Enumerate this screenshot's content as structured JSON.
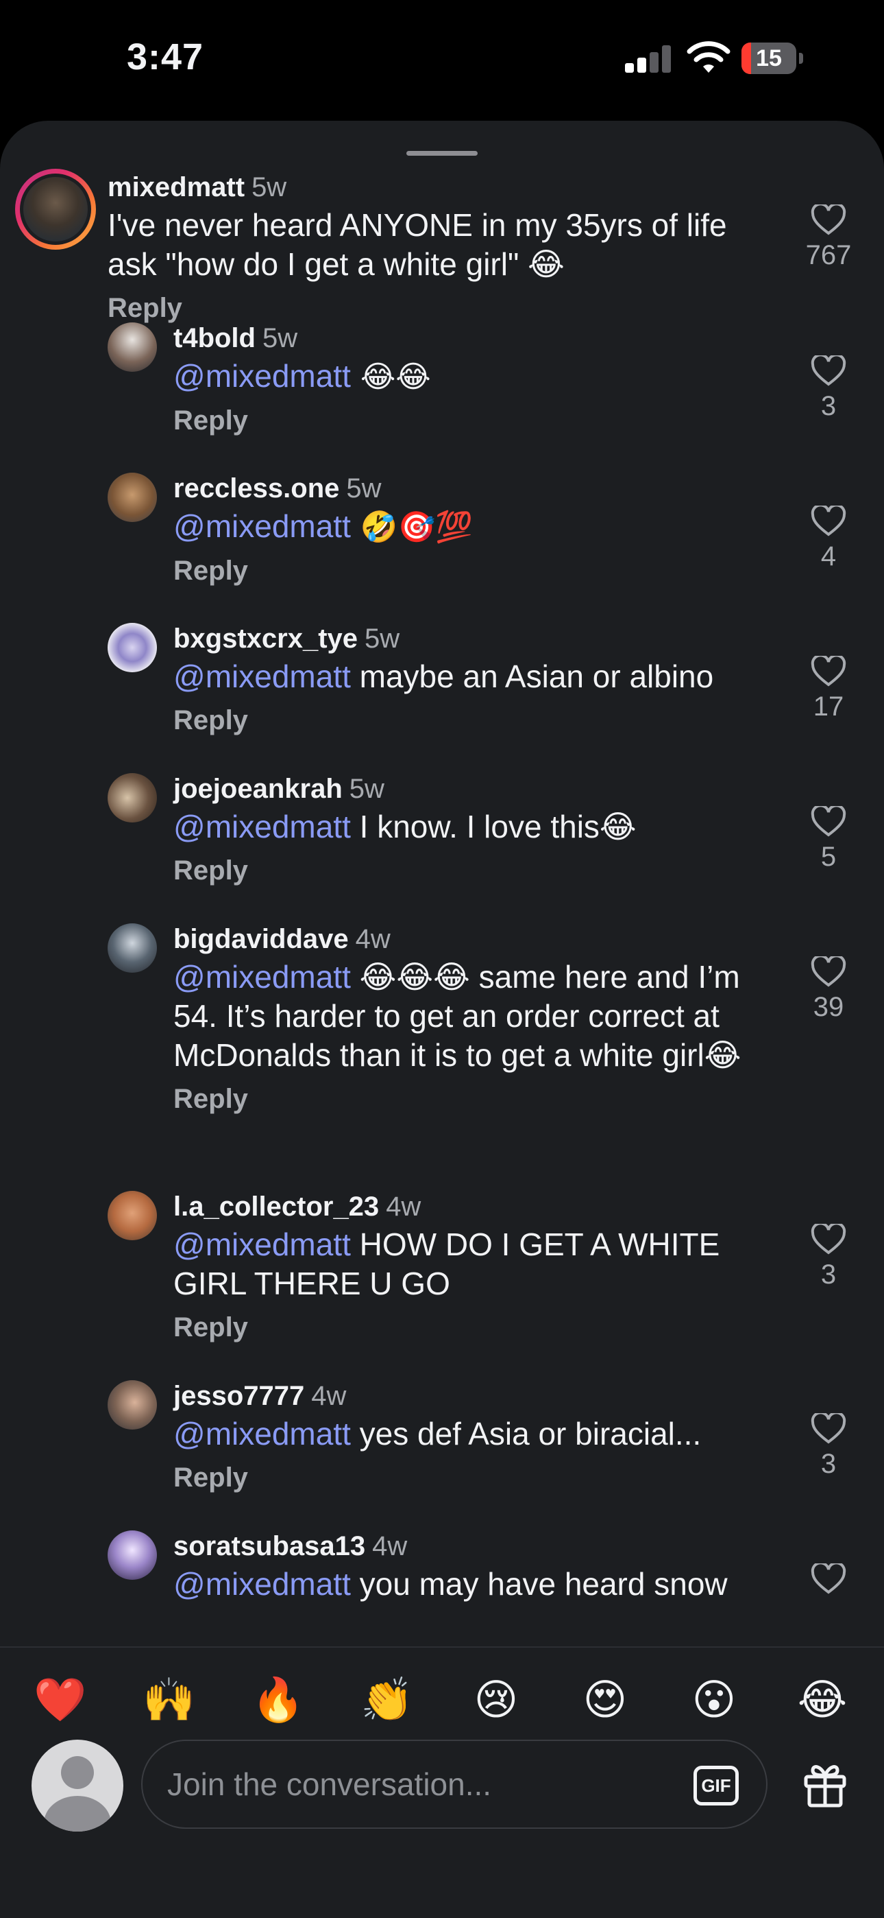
{
  "status_bar": {
    "time": "3:47",
    "battery": "15"
  },
  "comments": [
    {
      "username": "mixedmatt",
      "ago": "5w",
      "mention": "",
      "text": "I've never heard ANYONE in my 35yrs of life ask \"how do I get a white girl\" 😂",
      "likes": "767",
      "reply_label": "Reply"
    },
    {
      "username": "t4bold",
      "ago": "5w",
      "mention": "@mixedmatt",
      "text": " 😂😂",
      "likes": "3",
      "reply_label": "Reply"
    },
    {
      "username": "reccless.one",
      "ago": "5w",
      "mention": "@mixedmatt",
      "text": " 🤣🎯💯",
      "likes": "4",
      "reply_label": "Reply"
    },
    {
      "username": "bxgstxcrx_tye",
      "ago": "5w",
      "mention": "@mixedmatt",
      "text": " maybe an Asian or albino",
      "likes": "17",
      "reply_label": "Reply"
    },
    {
      "username": "joejoeankrah",
      "ago": "5w",
      "mention": "@mixedmatt",
      "text": " I know. I love this😂",
      "likes": "5",
      "reply_label": "Reply"
    },
    {
      "username": "bigdaviddave",
      "ago": "4w",
      "mention": "@mixedmatt",
      "text": " 😂😂😂 same here and I’m 54. It’s harder to get an order correct at McDonalds than it is to get a white girl😂",
      "likes": "39",
      "reply_label": "Reply"
    },
    {
      "username": "l.a_collector_23",
      "ago": "4w",
      "mention": "@mixedmatt",
      "text": " HOW DO I GET A WHITE GIRL THERE U GO",
      "likes": "3",
      "reply_label": "Reply"
    },
    {
      "username": "jesso7777",
      "ago": "4w",
      "mention": "@mixedmatt",
      "text": " yes def Asia or biracial...",
      "likes": "3",
      "reply_label": "Reply"
    },
    {
      "username": "soratsubasa13",
      "ago": "4w",
      "mention": "@mixedmatt",
      "text": " you may have heard snow",
      "likes": "",
      "reply_label": ""
    }
  ],
  "quick_reactions": [
    "❤️",
    "🙌",
    "🔥",
    "👏",
    "😢",
    "😍",
    "😮",
    "😂"
  ],
  "composer": {
    "placeholder": "Join the conversation...",
    "gif_label": "GIF"
  },
  "colors": {
    "background": "#1c1e21",
    "mention": "#8a9bf5",
    "muted": "#a8abb0",
    "battery_low": "#ff3b30"
  }
}
